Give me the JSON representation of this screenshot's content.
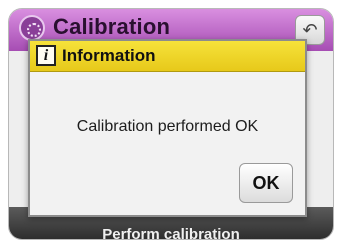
{
  "app": {
    "title": "Calibration",
    "back_icon": "undo-arrow-icon",
    "bottom_label": "Perform calibration"
  },
  "dialog": {
    "title": "Information",
    "icon": "info-icon",
    "message": "Calibration performed OK",
    "ok_label": "OK"
  },
  "colors": {
    "header_accent": "#a64db3",
    "dialog_titlebar": "#e7c91a"
  }
}
